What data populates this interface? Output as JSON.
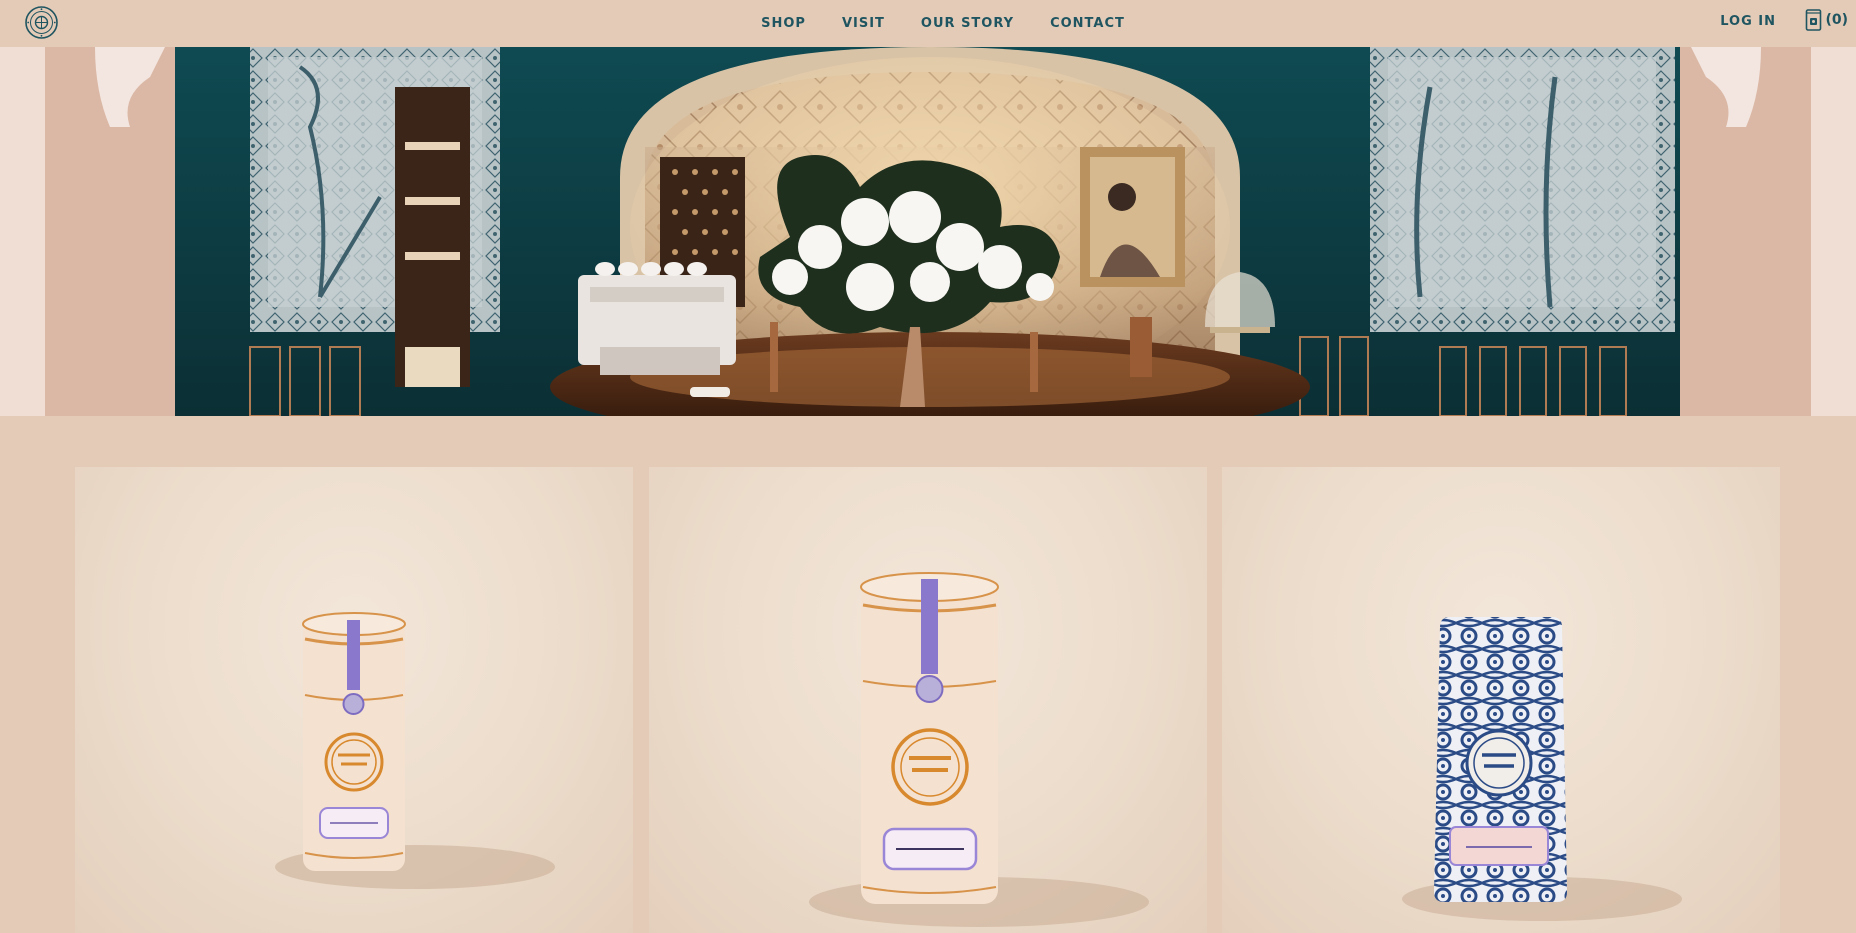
{
  "brand": {
    "logo_icon": "felix-roasting-co-seal-icon"
  },
  "nav": {
    "items": [
      {
        "label": "SHOP"
      },
      {
        "label": "VISIT"
      },
      {
        "label": "OUR STORY"
      },
      {
        "label": "CONTACT"
      }
    ]
  },
  "account": {
    "login_label": "LOG IN",
    "cart_icon": "coffee-bag-cart-icon",
    "cart_count": "(0)"
  },
  "hero": {
    "image": "cafe-interior-photo"
  },
  "products": [
    {
      "image": "tall-cream-tin-product-photo"
    },
    {
      "image": "tall-cream-tin-product-photo"
    },
    {
      "image": "blue-floral-coffee-bag-product-photo"
    }
  ],
  "colors": {
    "background": "#e4cbb8",
    "nav_text": "#1f5560",
    "teal_wall": "#14454a",
    "accent_orange": "#d9882f",
    "accent_purple": "#8b78c9",
    "bag_blue": "#2b4b86"
  }
}
